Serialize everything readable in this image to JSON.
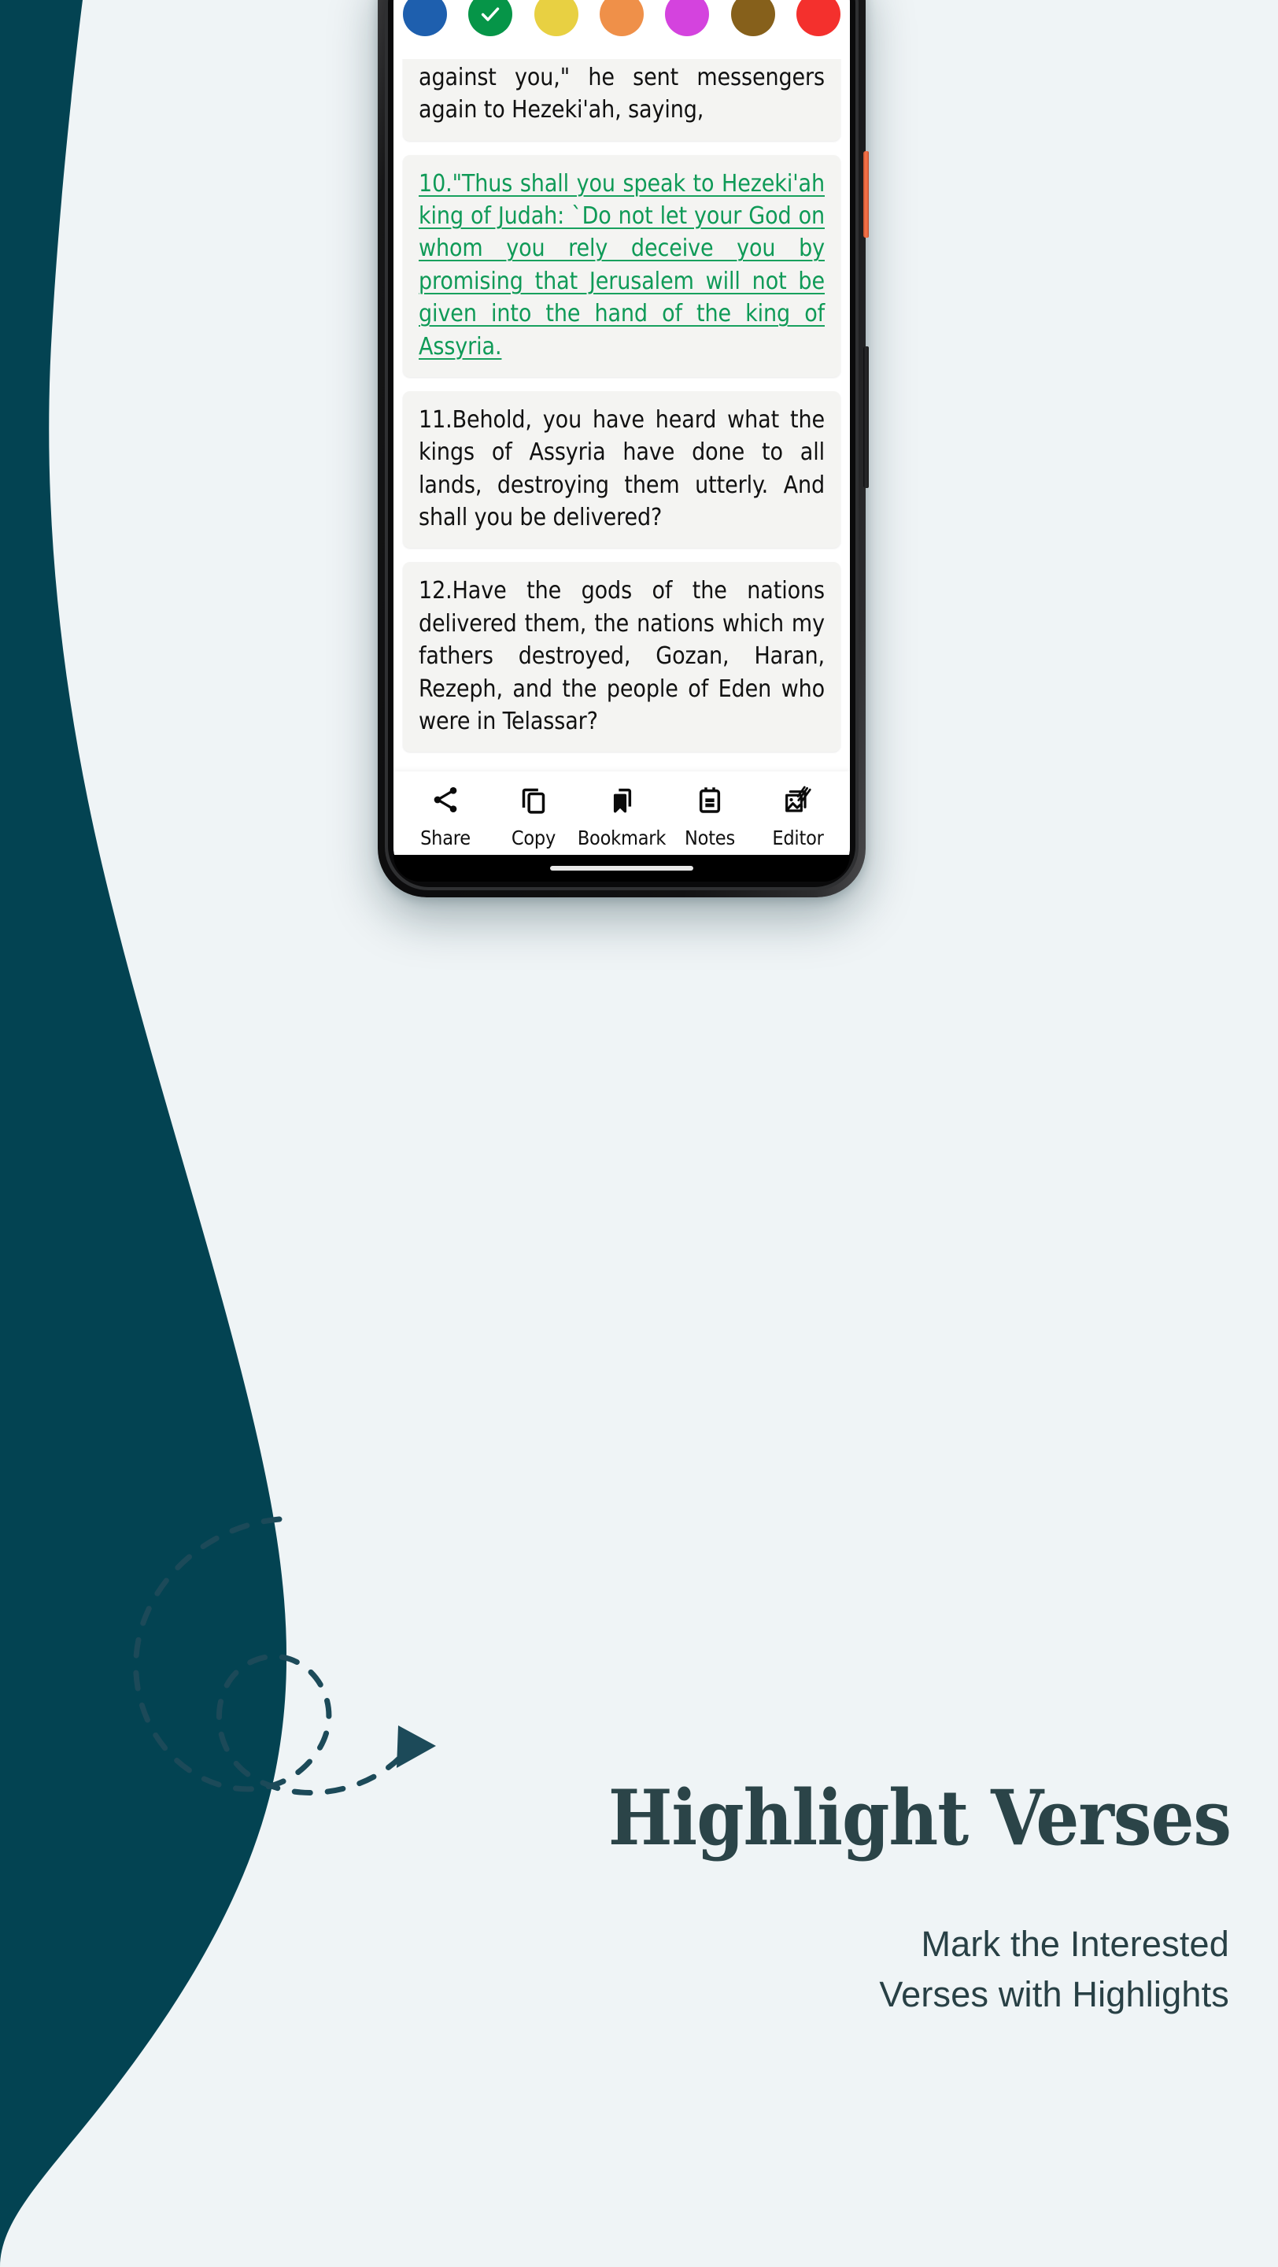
{
  "theme": {
    "page_background": "#eff4f6",
    "blob_teal": "#034352",
    "headline_color": "#2b4448",
    "subcopy_color": "#284045",
    "highlight_green": "#0f9a57",
    "card_background": "#f4f4f2",
    "arrow_color": "#1c4a59"
  },
  "phone": {
    "power_button_color": "#ee6a40",
    "volume_button_color": "#1a1a1b"
  },
  "color_picker": {
    "name": "highlight-color-picker",
    "selected_index": 1,
    "swatches": [
      {
        "name": "blue",
        "color": "#1e5fae",
        "selected": false
      },
      {
        "name": "green",
        "color": "#069548",
        "selected": true
      },
      {
        "name": "yellow",
        "color": "#e8d042",
        "selected": false
      },
      {
        "name": "orange",
        "color": "#ef9049",
        "selected": false
      },
      {
        "name": "magenta",
        "color": "#d443de",
        "selected": false
      },
      {
        "name": "brown",
        "color": "#86601b",
        "selected": false
      },
      {
        "name": "red",
        "color": "#f4302d",
        "selected": false
      }
    ]
  },
  "verses": [
    {
      "number": "",
      "text": "concerning Tirha'kah king of Ethiopia, \"Behold, he has set out to fight against you,\" he sent messengers again to Hezeki'ah, saying,",
      "highlighted": false,
      "clipped": true
    },
    {
      "number": "10.",
      "text": "10.\"Thus shall you speak to Hezeki'ah king of Judah: `Do not let your God on whom you rely deceive you by promising that Jerusalem will not be given into the hand of the king of Assyria.",
      "highlighted": true,
      "clipped": false
    },
    {
      "number": "11.",
      "text": "11.Behold, you have heard what the kings of Assyria have done to all lands, destroying them utterly. And shall you be delivered?",
      "highlighted": false,
      "clipped": false
    },
    {
      "number": "12.",
      "text": "12.Have the gods of the nations delivered them, the nations which my fathers destroyed, Gozan, Haran, Rezeph, and the people of Eden who were in Telassar?",
      "highlighted": false,
      "clipped": false
    }
  ],
  "action_bar": {
    "items": [
      {
        "icon": "share-icon",
        "label": "Share"
      },
      {
        "icon": "copy-icon",
        "label": "Copy"
      },
      {
        "icon": "bookmark-icon",
        "label": "Bookmark"
      },
      {
        "icon": "notes-icon",
        "label": "Notes"
      },
      {
        "icon": "editor-icon",
        "label": "Editor"
      }
    ]
  },
  "marketing": {
    "headline": "Highlight Verses",
    "subcopy_line1": "Mark the Interested",
    "subcopy_line2": "Verses with Highlights"
  }
}
